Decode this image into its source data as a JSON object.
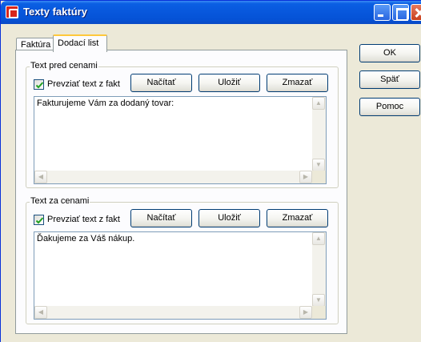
{
  "window": {
    "title": "Texty faktúry"
  },
  "title_buttons": {
    "minimize": "minimize-icon",
    "maximize": "maximize-icon",
    "close": "close-icon"
  },
  "tabs": [
    {
      "label": "Faktúra",
      "active": false
    },
    {
      "label": "Dodací list",
      "active": true
    }
  ],
  "groups": [
    {
      "label": "Text pred cenami",
      "checkbox": {
        "label": "Prevziať text z faktúry",
        "checked": true
      },
      "buttons": {
        "load": "Načítať",
        "save": "Uložiť",
        "clear": "Zmazať"
      },
      "text": "Fakturujeme Vám za dodaný tovar:"
    },
    {
      "label": "Text za cenami",
      "checkbox": {
        "label": "Prevziať text z faktúry",
        "checked": true
      },
      "buttons": {
        "load": "Načítať",
        "save": "Uložiť",
        "clear": "Zmazať"
      },
      "text": "Ďakujeme za Váš nákup."
    }
  ],
  "side_buttons": {
    "ok": "OK",
    "back": "Späť",
    "help": "Pomoc"
  },
  "colors": {
    "titlebar": "#0858dd",
    "dialog": "#ece9d8",
    "panel": "#fcfcfe",
    "active_tab_accent": "#ffc83c"
  }
}
